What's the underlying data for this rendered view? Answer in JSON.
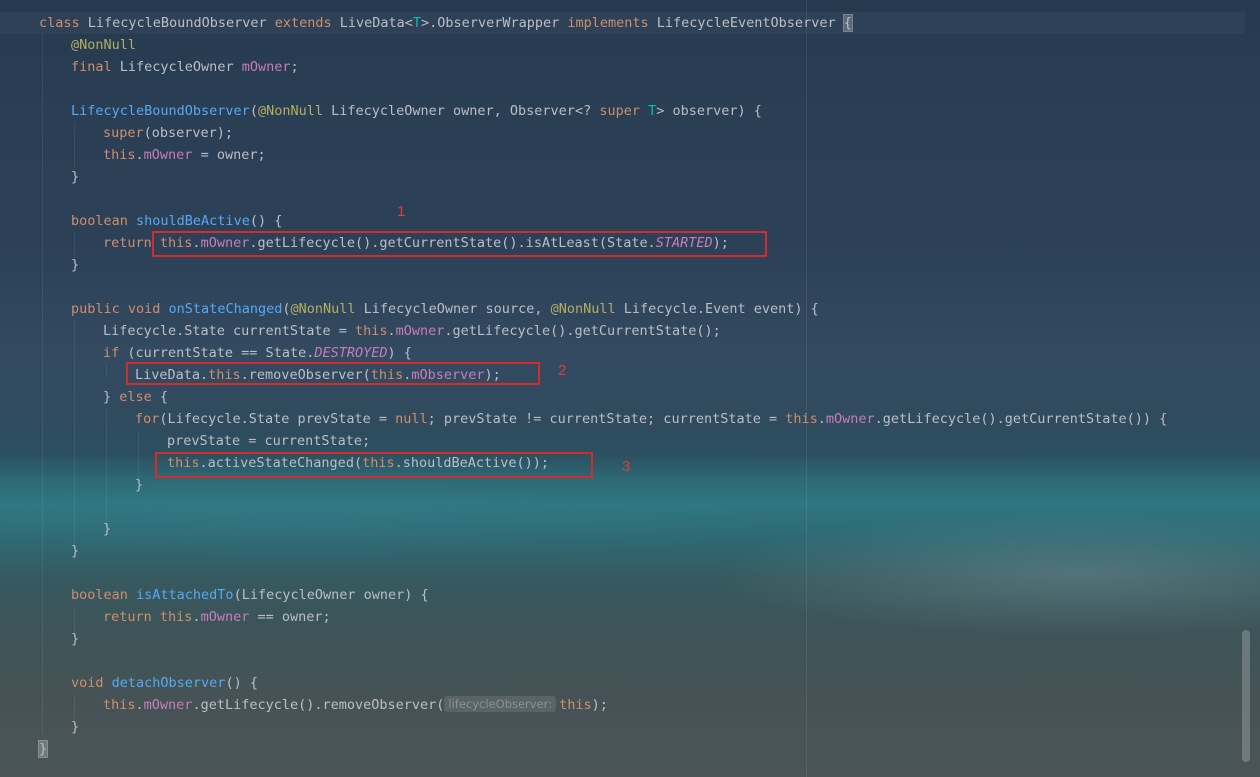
{
  "editor": {
    "lines": {
      "l01": {
        "a": "class ",
        "b": "LifecycleBoundObserver ",
        "c": "extends ",
        "d": "LiveData<",
        "e": "T",
        "f": ">.ObserverWrapper ",
        "g": "implements ",
        "h": "LifecycleEventObserver ",
        "i": "{"
      },
      "l02": {
        "a": "@NonNull"
      },
      "l03": {
        "a": "final ",
        "b": "LifecycleOwner ",
        "c": "mOwner",
        "d": ";"
      },
      "l05": {
        "a": "LifecycleBoundObserver",
        "b": "(",
        "c": "@NonNull ",
        "d": "LifecycleOwner owner, Observer<? ",
        "e": "super ",
        "f": "T",
        "g": "> observer) {"
      },
      "l06": {
        "a": "super",
        "b": "(observer);"
      },
      "l07": {
        "a": "this",
        "b": ".",
        "c": "mOwner",
        "d": " = owner;"
      },
      "l08": {
        "a": "}"
      },
      "l10": {
        "a": "boolean ",
        "b": "shouldBeActive",
        "c": "() {"
      },
      "l11": {
        "a": "return ",
        "b": "this",
        "c": ".",
        "d": "mOwner",
        "e": ".getLifecycle().getCurrentState().isAtLeast(State.",
        "f": "STARTED",
        "g": ");"
      },
      "l12": {
        "a": "}"
      },
      "l14": {
        "a": "public ",
        "b": "void ",
        "c": "onStateChanged",
        "d": "(",
        "e": "@NonNull ",
        "f": "LifecycleOwner source, ",
        "g": "@NonNull ",
        "h": "Lifecycle.Event event) {"
      },
      "l15": {
        "a": "Lifecycle.State currentState = ",
        "b": "this",
        "c": ".",
        "d": "mOwner",
        "e": ".getLifecycle().getCurrentState();"
      },
      "l16": {
        "a": "if ",
        "b": "(currentState == State.",
        "c": "DESTROYED",
        "d": ") {"
      },
      "l17": {
        "a": "LiveData.",
        "b": "this",
        "c": ".removeObserver(",
        "d": "this",
        "e": ".",
        "f": "mObserver",
        "g": ");"
      },
      "l18": {
        "a": "} ",
        "b": "else ",
        "c": "{"
      },
      "l19": {
        "a": "for",
        "b": "(Lifecycle.State prevState = ",
        "c": "null",
        "d": "; prevState != currentState; currentState = ",
        "e": "this",
        "f": ".",
        "g": "mOwner",
        "h": ".getLifecycle().getCurrentState()) {"
      },
      "l20": {
        "a": "prevState = currentState;"
      },
      "l21": {
        "a": "this",
        "b": ".activeStateChanged(",
        "c": "this",
        "d": ".shouldBeActive());"
      },
      "l22": {
        "a": "}"
      },
      "l24": {
        "a": "}"
      },
      "l25": {
        "a": "}"
      },
      "l27": {
        "a": "boolean ",
        "b": "isAttachedTo",
        "c": "(LifecycleOwner owner) {"
      },
      "l28": {
        "a": "return ",
        "b": "this",
        "c": ".",
        "d": "mOwner",
        "e": " == owner;"
      },
      "l29": {
        "a": "}"
      },
      "l31": {
        "a": "void ",
        "b": "detachObserver",
        "c": "() {"
      },
      "l32": {
        "a": "this",
        "b": ".",
        "c": "mOwner",
        "d": ".getLifecycle().removeObserver(",
        "e": "lifecycleObserver:",
        "f": "this",
        "g": ");"
      },
      "l33": {
        "a": "}"
      },
      "l34": {
        "a": "}"
      }
    }
  },
  "annotations": {
    "box1": {
      "number": "1"
    },
    "box2": {
      "number": "2"
    },
    "box3": {
      "number": "3"
    }
  },
  "colors": {
    "keyword": "#cf8e6d",
    "annotation": "#b3ae60",
    "field": "#c77dbb",
    "method": "#56a8f5",
    "type_param": "#16baac",
    "text": "#bcbec4",
    "red_box": "#d42c2c"
  }
}
